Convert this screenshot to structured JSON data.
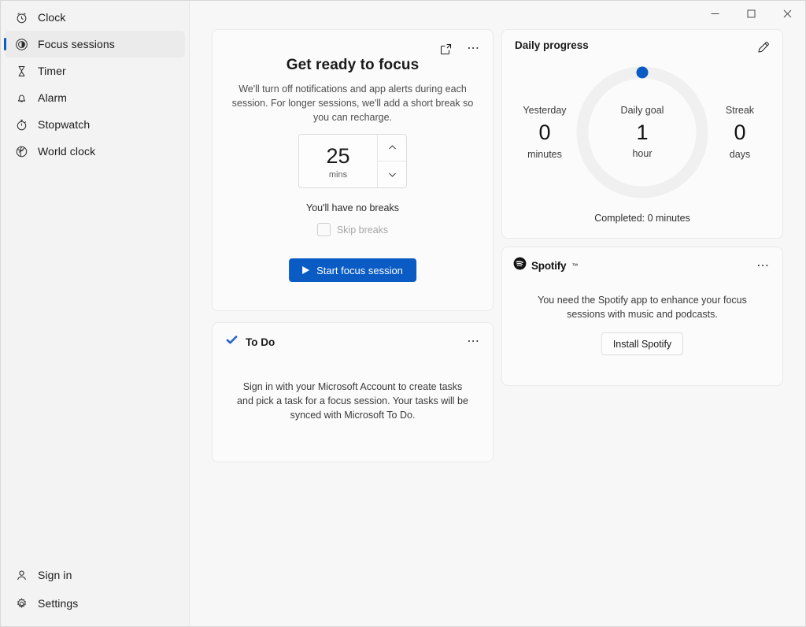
{
  "window": {
    "controls": {
      "minimize": "minimize-button",
      "maximize": "maximize-button",
      "close": "close-button"
    }
  },
  "sidebar": {
    "items": [
      {
        "label": "Clock",
        "icon": "clock-icon",
        "selected": false
      },
      {
        "label": "Focus sessions",
        "icon": "focus-icon",
        "selected": true
      },
      {
        "label": "Timer",
        "icon": "hourglass-icon",
        "selected": false
      },
      {
        "label": "Alarm",
        "icon": "bell-icon",
        "selected": false
      },
      {
        "label": "Stopwatch",
        "icon": "stopwatch-icon",
        "selected": false
      },
      {
        "label": "World clock",
        "icon": "globe-icon",
        "selected": false
      }
    ],
    "bottom": [
      {
        "label": "Sign in",
        "icon": "person-icon"
      },
      {
        "label": "Settings",
        "icon": "gear-icon"
      }
    ]
  },
  "focus_card": {
    "title": "Get ready to focus",
    "description": "We'll turn off notifications and app alerts during each session. For longer sessions, we'll add a short break so you can recharge.",
    "spinner": {
      "value": "25",
      "unit": "mins"
    },
    "breaks_text": "You'll have no breaks",
    "skip_breaks_label": "Skip breaks",
    "skip_breaks_checked": false,
    "start_button": "Start focus session",
    "popout_icon": "pop-out-icon",
    "more_icon": "more-options-icon"
  },
  "todo_card": {
    "title": "To Do",
    "icon": "todo-check-icon",
    "body": "Sign in with your Microsoft Account to create tasks and pick a task for a focus session. Your tasks will be synced with Microsoft To Do.",
    "more_icon": "more-options-icon"
  },
  "progress_card": {
    "title": "Daily progress",
    "edit_icon": "edit-pencil-icon",
    "yesterday": {
      "caption": "Yesterday",
      "value": "0",
      "unit": "minutes"
    },
    "goal": {
      "caption": "Daily goal",
      "value": "1",
      "unit": "hour"
    },
    "streak": {
      "caption": "Streak",
      "value": "0",
      "unit": "days"
    },
    "completed": "Completed: 0 minutes",
    "ring": {
      "percent": 0,
      "track_color": "#f0f0f0",
      "fill_color": "#0a5bc4"
    }
  },
  "spotify_card": {
    "brand": "Spotify",
    "trademark": "™",
    "icon": "spotify-logo-icon",
    "body": "You need the Spotify app to enhance your focus sessions with music and podcasts.",
    "install_button": "Install Spotify",
    "more_icon": "more-options-icon"
  },
  "colors": {
    "accent": "#0a5bc4",
    "sidebar_bg": "#f3f3f3",
    "content_bg": "#f7f7f7",
    "card_bg": "#fbfbfb",
    "ring_track": "#f0f0f0"
  }
}
